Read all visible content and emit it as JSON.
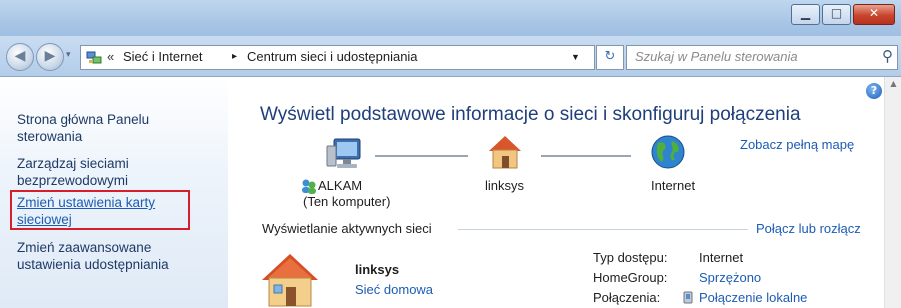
{
  "address": {
    "crumb1": "Sieć i Internet",
    "crumb2": "Centrum sieci i udostępniania",
    "chevron": "«",
    "separator": "▸"
  },
  "search": {
    "placeholder": "Szukaj w Panelu sterowania"
  },
  "sidebar": {
    "items": [
      {
        "line1": "Strona główna Panelu",
        "line2": "sterowania"
      },
      {
        "line1": "Zarządzaj sieciami",
        "line2": "bezprzewodowymi"
      },
      {
        "line1": "Zmień ustawienia karty",
        "line2": "sieciowej"
      },
      {
        "line1": "Zmień zaawansowane",
        "line2": "ustawienia udostępniania"
      }
    ]
  },
  "main": {
    "title": "Wyświetl podstawowe informacje o sieci i skonfiguruj połączenia",
    "full_map_link": "Zobacz pełną mapę",
    "map": {
      "computer_name": "ALKAM",
      "computer_sub": "(Ten komputer)",
      "router": "linksys",
      "internet": "Internet"
    },
    "active_header": "Wyświetlanie aktywnych sieci",
    "connect_link": "Połącz lub rozłącz",
    "network": {
      "name": "linksys",
      "type": "Sieć domowa"
    },
    "details": {
      "access_label": "Typ dostępu:",
      "access_value": "Internet",
      "homegroup_label": "HomeGroup:",
      "homegroup_value": "Sprzężono",
      "connections_label": "Połączenia:",
      "connections_value": "Połączenie lokalne"
    }
  },
  "colors": {
    "highlight_box": "#d61f2c",
    "link": "#1c5cb4",
    "title": "#1f3f7a"
  },
  "icons": {
    "back": "back-arrow-icon",
    "forward": "forward-arrow-icon",
    "search": "search-icon",
    "help": "help-icon"
  }
}
